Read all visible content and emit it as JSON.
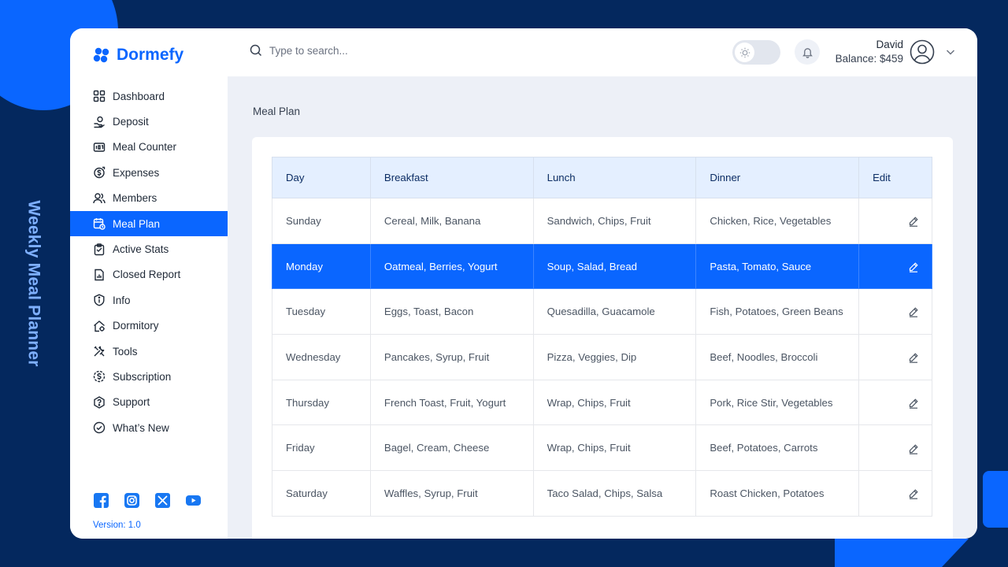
{
  "side_caption": "Weekly Meal Planner",
  "brand": {
    "name": "Dormefy",
    "color": "#0a66ff"
  },
  "search": {
    "placeholder": "Type to search..."
  },
  "user": {
    "name": "David",
    "balance": "Balance: $459"
  },
  "sidebar": {
    "items": [
      {
        "label": "Dashboard",
        "icon": "dashboard-icon"
      },
      {
        "label": "Deposit",
        "icon": "deposit-icon"
      },
      {
        "label": "Meal Counter",
        "icon": "counter-icon"
      },
      {
        "label": "Expenses",
        "icon": "expenses-icon"
      },
      {
        "label": "Members",
        "icon": "members-icon"
      },
      {
        "label": "Meal Plan",
        "icon": "calendar-icon",
        "active": true
      },
      {
        "label": "Active Stats",
        "icon": "clipboard-icon"
      },
      {
        "label": "Closed Report",
        "icon": "report-icon"
      },
      {
        "label": "Info",
        "icon": "info-icon"
      },
      {
        "label": "Dormitory",
        "icon": "house-icon"
      },
      {
        "label": "Tools",
        "icon": "tools-icon"
      },
      {
        "label": "Subscription",
        "icon": "dollar-icon"
      },
      {
        "label": "Support",
        "icon": "support-icon"
      },
      {
        "label": "What’s New",
        "icon": "check-circle-icon"
      }
    ],
    "socials": [
      "facebook-icon",
      "instagram-icon",
      "x-icon",
      "youtube-icon"
    ],
    "version": "Version: 1.0"
  },
  "page": {
    "title": "Meal Plan"
  },
  "table": {
    "headers": [
      "Day",
      "Breakfast",
      "Lunch",
      "Dinner",
      "Edit"
    ],
    "rows": [
      {
        "day": "Sunday",
        "breakfast": "Cereal, Milk, Banana",
        "lunch": "Sandwich,  Chips, Fruit",
        "dinner": "Chicken, Rice, Vegetables"
      },
      {
        "day": "Monday",
        "breakfast": "Oatmeal, Berries, Yogurt",
        "lunch": "Soup, Salad, Bread",
        "dinner": "Pasta, Tomato, Sauce",
        "active": true
      },
      {
        "day": "Tuesday",
        "breakfast": "Eggs, Toast, Bacon",
        "lunch": "Quesadilla, Guacamole",
        "dinner": "Fish, Potatoes, Green Beans"
      },
      {
        "day": "Wednesday",
        "breakfast": "Pancakes, Syrup, Fruit",
        "lunch": "Pizza, Veggies, Dip",
        "dinner": "Beef, Noodles, Broccoli"
      },
      {
        "day": "Thursday",
        "breakfast": "French Toast, Fruit, Yogurt",
        "lunch": "Wrap, Chips, Fruit",
        "dinner": "Pork, Rice Stir, Vegetables"
      },
      {
        "day": "Friday",
        "breakfast": "Bagel, Cream, Cheese",
        "lunch": "Wrap, Chips, Fruit",
        "dinner": "Beef, Potatoes, Carrots"
      },
      {
        "day": "Saturday",
        "breakfast": "Waffles, Syrup, Fruit",
        "lunch": "Taco Salad, Chips, Salsa",
        "dinner": "Roast Chicken, Potatoes"
      }
    ]
  }
}
